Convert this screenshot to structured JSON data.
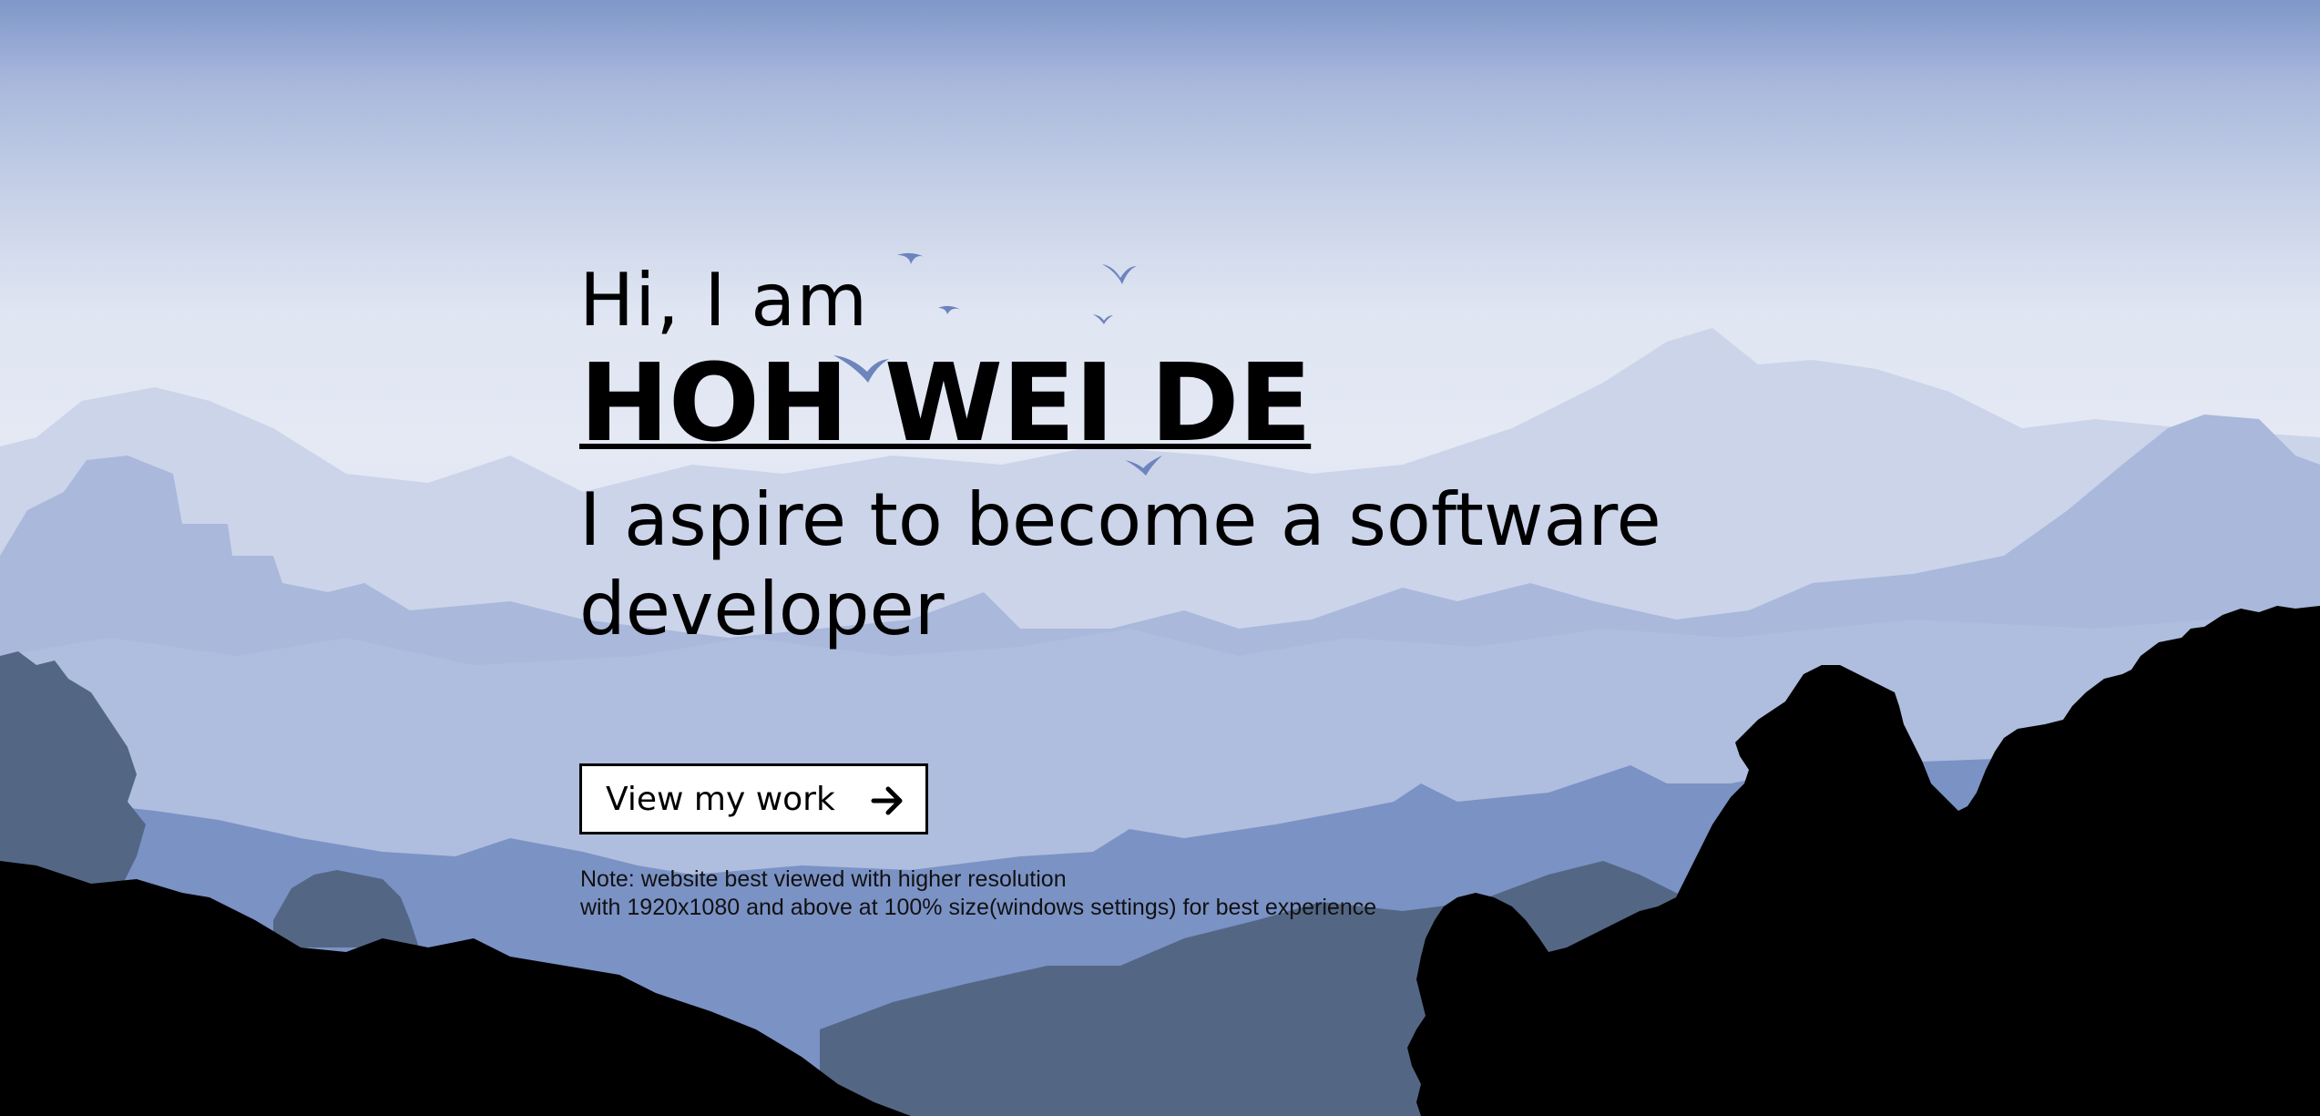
{
  "hero": {
    "greeting": "Hi, I am",
    "name": "HOH WEI DE",
    "tagline": "I aspire to become a software developer",
    "cta_label": "View my work",
    "note_line1": "Note: website best viewed with higher resolution",
    "note_line2": "with 1920x1080 and above at 100% size(windows settings) for best experience"
  },
  "icons": {
    "cta": "arrow-right-icon"
  },
  "colors": {
    "sky_top": "#7f97c9",
    "sky_mid": "#e4e9f4",
    "mountain_far": "#cdd5ea",
    "mountain_mid": "#aab9dc",
    "mountain_near": "#7b92c5",
    "mountain_dark": "#536785",
    "foreground": "#000000",
    "birds": "#6d84bd"
  }
}
